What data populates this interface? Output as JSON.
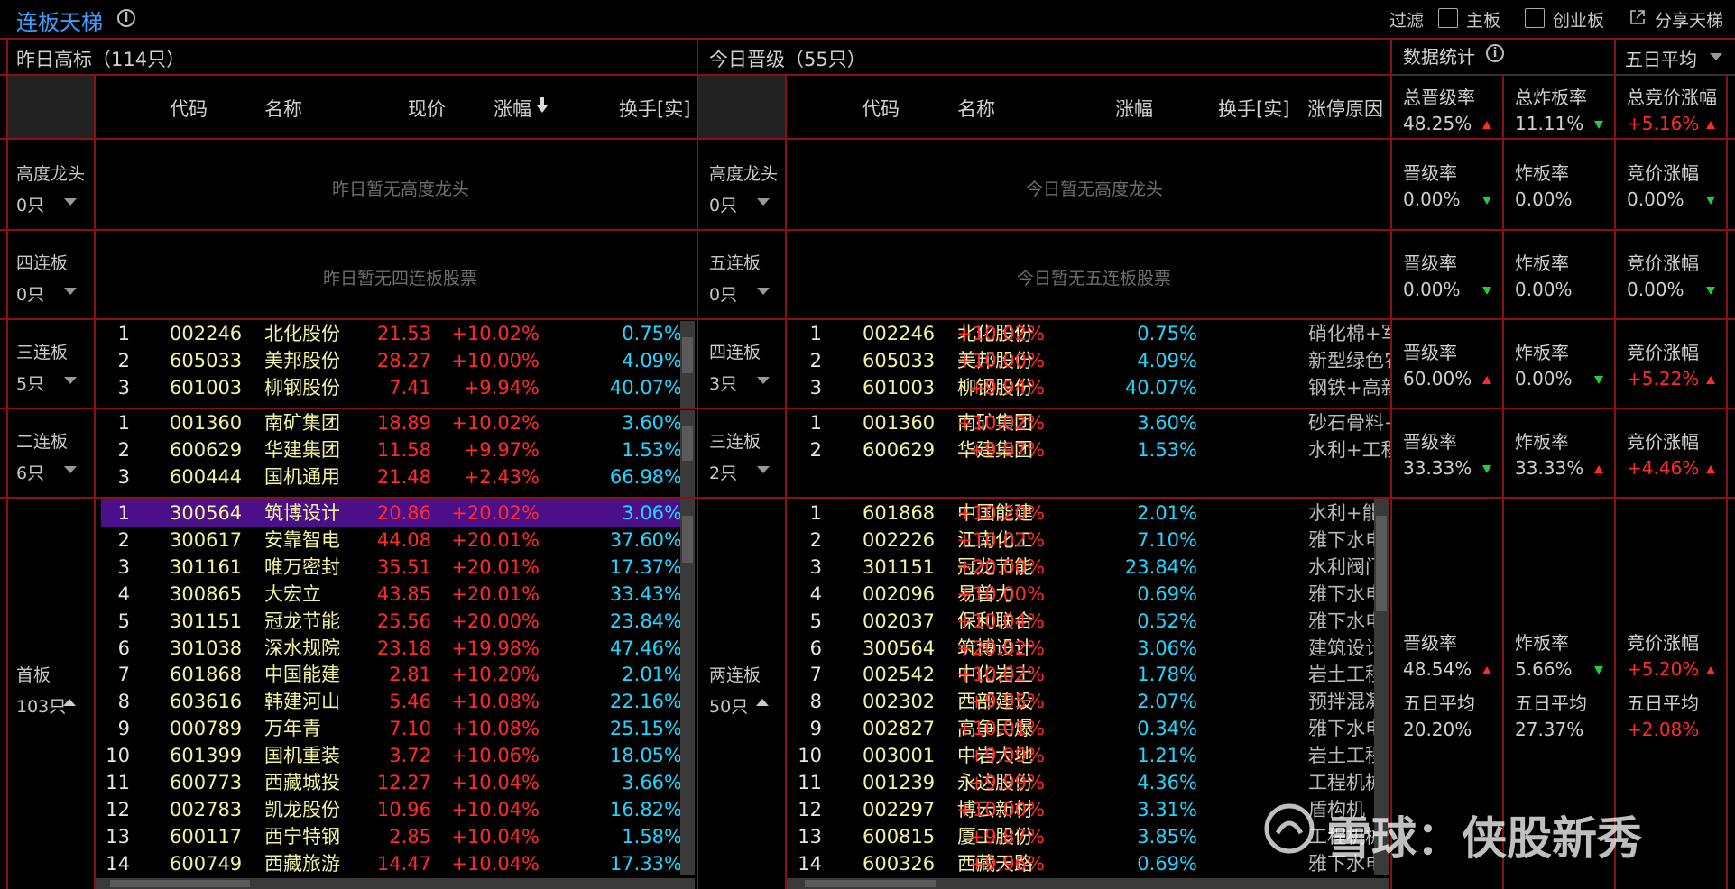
{
  "app": {
    "title": "连板天梯"
  },
  "toolbar": {
    "filter": "过滤",
    "main_board": "主板",
    "growth_board": "创业板",
    "share": "分享天梯"
  },
  "left": {
    "title": "昨日高标（114只）",
    "cols": {
      "code": "代码",
      "name": "名称",
      "price": "现价",
      "chg": "涨幅",
      "turnover": "换手[实]"
    },
    "groups": [
      {
        "label": "高度龙头",
        "count": "0只",
        "empty": "昨日暂无高度龙头"
      },
      {
        "label": "四连板",
        "count": "0只",
        "empty": "昨日暂无四连板股票"
      },
      {
        "label": "三连板",
        "count": "5只"
      },
      {
        "label": "二连板",
        "count": "6只"
      },
      {
        "label": "首板",
        "count": "103只"
      }
    ],
    "rows3": [
      [
        "1",
        "002246",
        "北化股份",
        "21.53",
        "+10.02%",
        "0.75%"
      ],
      [
        "2",
        "605033",
        "美邦股份",
        "28.27",
        "+10.00%",
        "4.09%"
      ],
      [
        "3",
        "601003",
        "柳钢股份",
        "7.41",
        "+9.94%",
        "40.07%"
      ]
    ],
    "rows2": [
      [
        "1",
        "001360",
        "南矿集团",
        "18.89",
        "+10.02%",
        "3.60%"
      ],
      [
        "2",
        "600629",
        "华建集团",
        "11.58",
        "+9.97%",
        "1.53%"
      ],
      [
        "3",
        "600444",
        "国机通用",
        "21.48",
        "+2.43%",
        "66.98%"
      ]
    ],
    "rows1": [
      [
        "1",
        "300564",
        "筑博设计",
        "20.86",
        "+20.02%",
        "3.06%"
      ],
      [
        "2",
        "300617",
        "安靠智电",
        "44.08",
        "+20.01%",
        "37.60%"
      ],
      [
        "3",
        "301161",
        "唯万密封",
        "35.51",
        "+20.01%",
        "17.37%"
      ],
      [
        "4",
        "300865",
        "大宏立",
        "43.85",
        "+20.01%",
        "33.43%"
      ],
      [
        "5",
        "301151",
        "冠龙节能",
        "25.56",
        "+20.00%",
        "23.84%"
      ],
      [
        "6",
        "301038",
        "深水规院",
        "23.18",
        "+19.98%",
        "47.46%"
      ],
      [
        "7",
        "601868",
        "中国能建",
        "2.81",
        "+10.20%",
        "2.01%"
      ],
      [
        "8",
        "603616",
        "韩建河山",
        "5.46",
        "+10.08%",
        "22.16%"
      ],
      [
        "9",
        "000789",
        "万年青",
        "7.10",
        "+10.08%",
        "25.15%"
      ],
      [
        "10",
        "601399",
        "国机重装",
        "3.72",
        "+10.06%",
        "18.05%"
      ],
      [
        "11",
        "600773",
        "西藏城投",
        "12.27",
        "+10.04%",
        "3.66%"
      ],
      [
        "12",
        "002783",
        "凯龙股份",
        "10.96",
        "+10.04%",
        "16.82%"
      ],
      [
        "13",
        "600117",
        "西宁特钢",
        "2.85",
        "+10.04%",
        "1.58%"
      ],
      [
        "14",
        "600749",
        "西藏旅游",
        "14.47",
        "+10.04%",
        "17.33%"
      ]
    ]
  },
  "mid": {
    "title": "今日晋级（55只）",
    "cols": {
      "code": "代码",
      "name": "名称",
      "chg": "涨幅",
      "turnover": "换手[实]",
      "reason": "涨停原因"
    },
    "groups": [
      {
        "label": "高度龙头",
        "count": "0只",
        "empty": "今日暂无高度龙头"
      },
      {
        "label": "五连板",
        "count": "0只",
        "empty": "今日暂无五连板股票"
      },
      {
        "label": "四连板",
        "count": "3只"
      },
      {
        "label": "三连板",
        "count": "2只"
      },
      {
        "label": "两连板",
        "count": "50只"
      }
    ],
    "rows4": [
      [
        "1",
        "002246",
        "北化股份",
        "+10.02%",
        "0.75%",
        "硝化棉+军"
      ],
      [
        "2",
        "605033",
        "美邦股份",
        "+10.00%",
        "4.09%",
        "新型绿色农"
      ],
      [
        "3",
        "601003",
        "柳钢股份",
        "+9.94%",
        "40.07%",
        "钢铁+高新"
      ]
    ],
    "rows3": [
      [
        "1",
        "001360",
        "南矿集团",
        "+10.02%",
        "3.60%",
        "砂石骨料+"
      ],
      [
        "2",
        "600629",
        "华建集团",
        "+9.97%",
        "1.53%",
        "水利+工程"
      ]
    ],
    "rows2": [
      [
        "1",
        "601868",
        "中国能建",
        "+10.20%",
        "2.01%",
        "水利+能"
      ],
      [
        "2",
        "002226",
        "江南化工",
        "+10.02%",
        "7.10%",
        "雅下水电"
      ],
      [
        "3",
        "301151",
        "冠龙节能",
        "+20.00%",
        "23.84%",
        "水利阀门"
      ],
      [
        "4",
        "002096",
        "易普力",
        "+10.00%",
        "0.69%",
        "雅下水电"
      ],
      [
        "5",
        "002037",
        "保利联合",
        "+10.04%",
        "0.52%",
        "雅下水电"
      ],
      [
        "6",
        "300564",
        "筑博设计",
        "+20.02%",
        "3.06%",
        "建筑设计"
      ],
      [
        "7",
        "002542",
        "中化岩土",
        "+10.02%",
        "1.78%",
        "岩土工程"
      ],
      [
        "8",
        "002302",
        "西部建设",
        "+9.95%",
        "2.07%",
        "预拌混凝"
      ],
      [
        "9",
        "002827",
        "高争民爆",
        "+10.01%",
        "0.34%",
        "雅下水电"
      ],
      [
        "10",
        "003001",
        "中岩大地",
        "+9.99%",
        "1.21%",
        "岩土工程"
      ],
      [
        "11",
        "001239",
        "永达股份",
        "+9.99%",
        "4.36%",
        "工程机械"
      ],
      [
        "12",
        "002297",
        "博云新材",
        "+10.00%",
        "3.31%",
        "盾构机"
      ],
      [
        "13",
        "600815",
        "厦工股份",
        "+9.87%",
        "3.85%",
        "工程机械"
      ],
      [
        "14",
        "600326",
        "西藏天路",
        "+9.96%",
        "0.69%",
        "雅下水电"
      ]
    ]
  },
  "stats": {
    "title": "数据统计",
    "period": "五日平均",
    "summary": [
      {
        "label": "总晋级率",
        "value": "48.25%",
        "dir": "up"
      },
      {
        "label": "总炸板率",
        "value": "11.11%",
        "dir": "down"
      },
      {
        "label": "总竞价涨幅",
        "value": "+5.16%",
        "dir": "up"
      }
    ],
    "rows": [
      [
        {
          "label": "晋级率",
          "value": "0.00%",
          "dir": "down"
        },
        {
          "label": "炸板率",
          "value": "0.00%",
          "dir": ""
        },
        {
          "label": "竞价涨幅",
          "value": "0.00%",
          "dir": "down"
        }
      ],
      [
        {
          "label": "晋级率",
          "value": "0.00%",
          "dir": "down"
        },
        {
          "label": "炸板率",
          "value": "0.00%",
          "dir": ""
        },
        {
          "label": "竞价涨幅",
          "value": "0.00%",
          "dir": "down"
        }
      ],
      [
        {
          "label": "晋级率",
          "value": "60.00%",
          "dir": "up"
        },
        {
          "label": "炸板率",
          "value": "0.00%",
          "dir": "down"
        },
        {
          "label": "竞价涨幅",
          "value": "+5.22%",
          "dir": "up"
        }
      ],
      [
        {
          "label": "晋级率",
          "value": "33.33%",
          "dir": "down"
        },
        {
          "label": "炸板率",
          "value": "33.33%",
          "dir": "up"
        },
        {
          "label": "竞价涨幅",
          "value": "+4.46%",
          "dir": "up"
        }
      ]
    ],
    "first": [
      {
        "label": "晋级率",
        "value": "48.54%",
        "dir": "up",
        "avg_label": "五日平均",
        "avg": "20.20%"
      },
      {
        "label": "炸板率",
        "value": "5.66%",
        "dir": "down",
        "avg_label": "五日平均",
        "avg": "27.37%"
      },
      {
        "label": "竞价涨幅",
        "value": "+5.20%",
        "dir": "up",
        "avg_label": "五日平均",
        "avg": "+2.08%"
      }
    ]
  },
  "watermark": "雪球：侠股新秀"
}
